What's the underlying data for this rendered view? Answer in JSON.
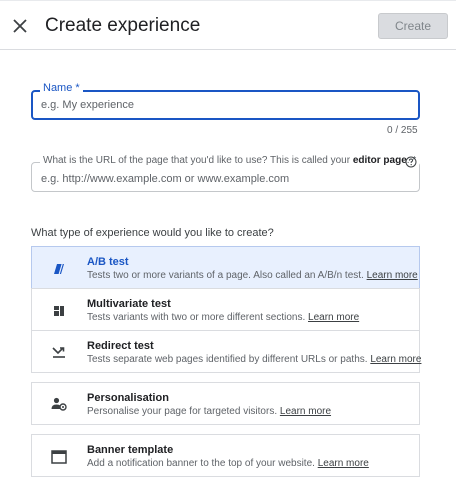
{
  "header": {
    "title": "Create experience",
    "create_label": "Create"
  },
  "name_field": {
    "label": "Name *",
    "placeholder": "e.g. My experience",
    "char_count": "0 / 255"
  },
  "url_field": {
    "label_prefix": "What is the URL of the page that you'd like to use? This is called your ",
    "label_bold": "editor page",
    "label_suffix": ". *",
    "placeholder": "e.g. http://www.example.com or www.example.com"
  },
  "question": "What type of experience would you like to create?",
  "options": [
    {
      "title": "A/B test",
      "description": "Tests two or more variants of a page. Also called an A/B/n test. ",
      "link": "Learn more",
      "icon": "ab-test-icon",
      "selected": true
    },
    {
      "title": "Multivariate test",
      "description": "Tests variants with two or more different sections. ",
      "link": "Learn more",
      "icon": "multivariate-icon",
      "selected": false
    },
    {
      "title": "Redirect test",
      "description": "Tests separate web pages identified by different URLs or paths. ",
      "link": "Learn more",
      "icon": "redirect-icon",
      "selected": false
    },
    {
      "title": "Personalisation",
      "description": "Personalise your page for targeted visitors. ",
      "link": "Learn more",
      "icon": "personalisation-icon",
      "selected": false
    },
    {
      "title": "Banner template",
      "description": "Add a notification banner to the top of your website. ",
      "link": "Learn more",
      "icon": "banner-icon",
      "selected": false
    }
  ],
  "colors": {
    "accent": "#1a56c4",
    "selected_bg": "#e8f0fe",
    "border": "#dadce0"
  }
}
